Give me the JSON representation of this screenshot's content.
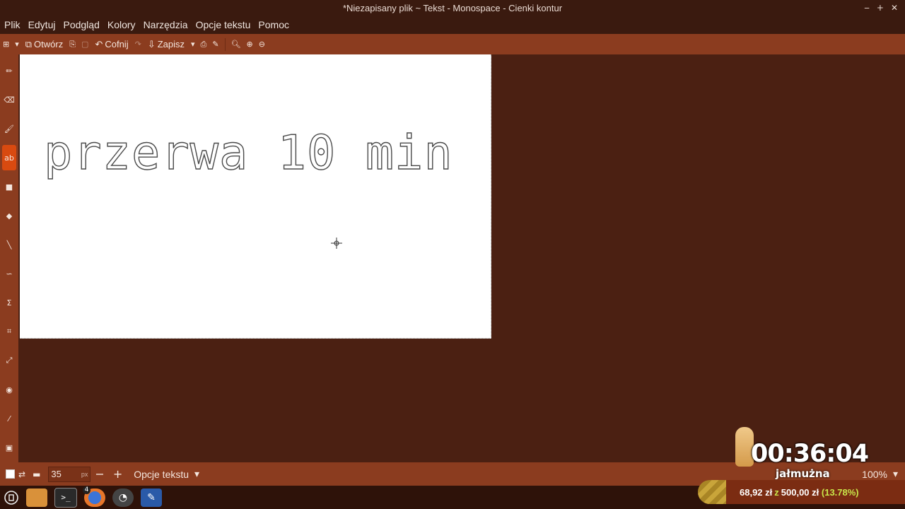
{
  "window": {
    "title": "*Niezapisany plik ~ Tekst - Monospace - Cienki kontur",
    "controls": [
      "‒",
      "+",
      "✕"
    ]
  },
  "menu": [
    "Plik",
    "Edytuj",
    "Podgląd",
    "Kolory",
    "Narzędzia",
    "Opcje tekstu",
    "Pomoc"
  ],
  "toolbar": {
    "open_label": "Otwórz",
    "undo_label": "Cofnij",
    "save_label": "Zapisz"
  },
  "canvas": {
    "text": "przerwa 10 min"
  },
  "bottom_bar": {
    "size_value": "35",
    "size_unit": "px",
    "minus": "−",
    "plus": "+",
    "text_options_label": "Opcje tekstu",
    "zoom_label": "100%"
  },
  "overlay": {
    "timer": "00:36:04",
    "label": "jałmużna"
  },
  "donation": {
    "current": "68,92 zł",
    "separator": "z",
    "goal": "500,00 zł",
    "percent_text": "(13.78%)",
    "progress_fraction": 0.1378
  },
  "taskbar": {
    "firefox_badge": "4"
  },
  "colors": {
    "accent": "#d94a10",
    "toolbar": "#8b3c1f",
    "background": "#4b2012",
    "progress_highlight": "#c9e64a"
  }
}
